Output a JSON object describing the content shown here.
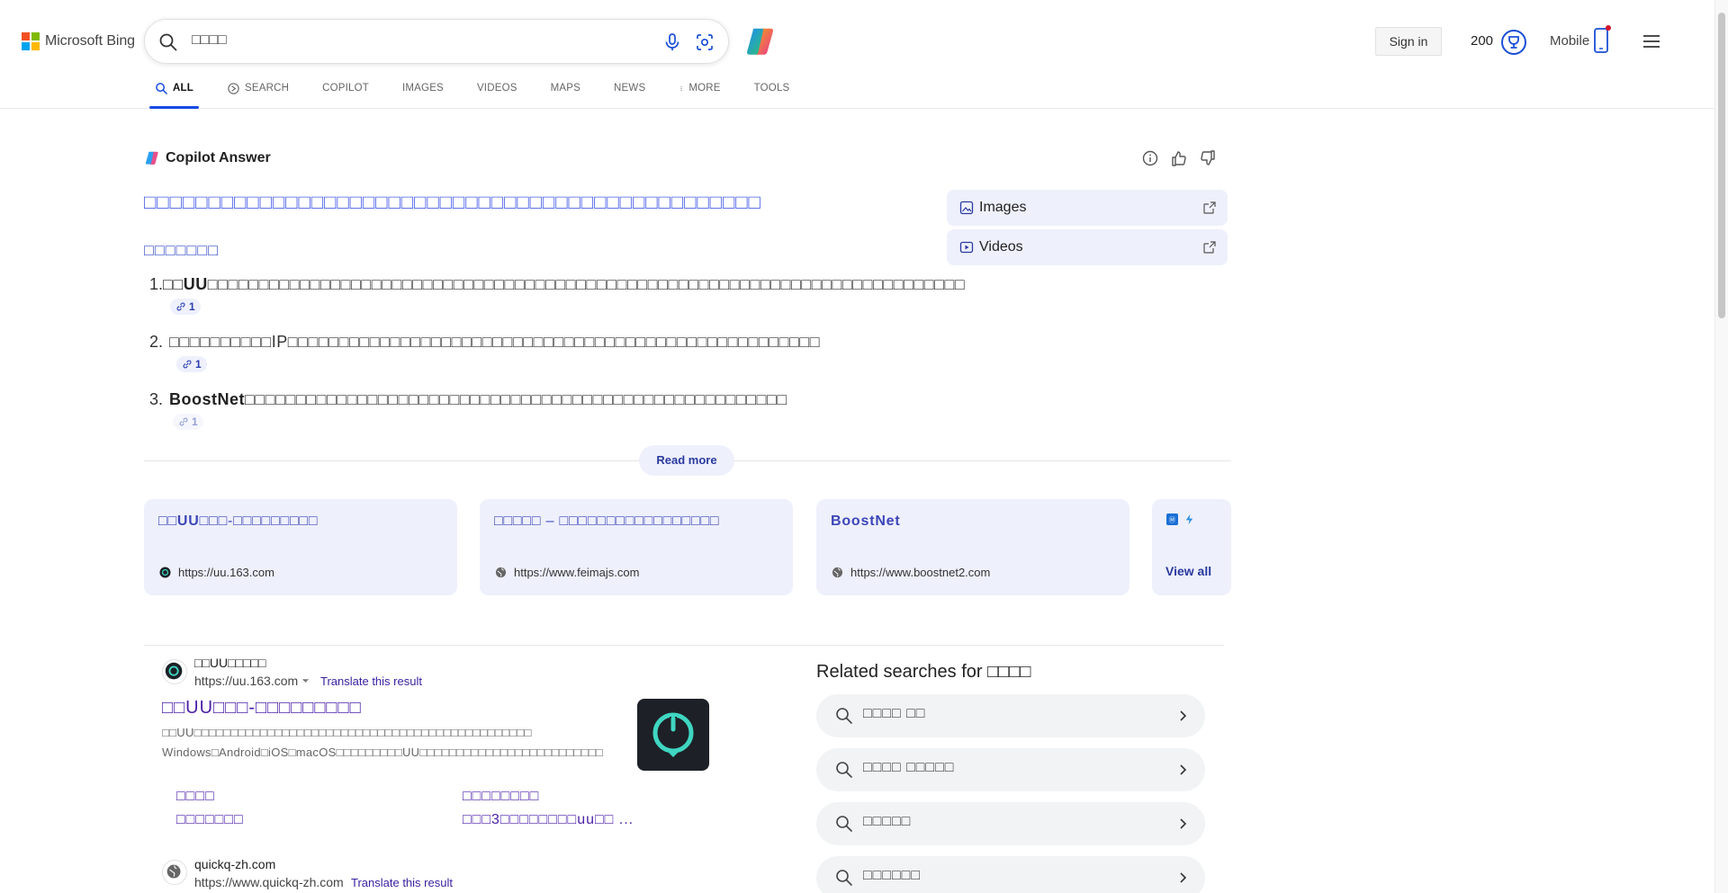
{
  "header": {
    "logo_text": "Microsoft Bing",
    "search_query": "□□□□",
    "signin_label": "Sign in",
    "points": "200",
    "mobile_label": "Mobile"
  },
  "tabs": [
    {
      "label": "ALL",
      "icon": "search-icon",
      "active": true
    },
    {
      "label": "SEARCH",
      "icon": "copilot-search-icon",
      "active": false
    },
    {
      "label": "COPILOT",
      "active": false
    },
    {
      "label": "IMAGES",
      "active": false
    },
    {
      "label": "VIDEOS",
      "active": false
    },
    {
      "label": "MAPS",
      "active": false
    },
    {
      "label": "NEWS",
      "active": false
    },
    {
      "label": "MORE",
      "icon": "more-vertical-icon",
      "active": false
    },
    {
      "label": "TOOLS",
      "active": false
    }
  ],
  "copilot_answer": {
    "header_label": "Copilot Answer",
    "title": "□□□□□□□□□□□□□□□□□□□□□□□□□□□□□□□□□□□□□□□□□□□□□□□□",
    "subhead": "□□□□□□□",
    "items": [
      {
        "num": "1.",
        "lead": "□□UU",
        "text": "□□□□□□□□□□□□□□□□□□□□□□□□□□□□□□□□□□□□□□□□□□□□□□□□□□□□□□□□□□□□□□□□□□□□□□□□□□",
        "cite": "1"
      },
      {
        "num": "2.",
        "lead": "",
        "text": "□□□□□□□□□□IP□□□□□□□□□□□□□□□□□□□□□□□□□□□□□□□□□□□□□□□□□□□□□□□□□□□□",
        "cite": "1"
      },
      {
        "num": "3.",
        "lead": "BoostNet",
        "text": "□□□□□□□□□□□□□□□□□□□□□□□□□□□□□□□□□□□□□□□□□□□□□□□□□□□□□",
        "cite": "1"
      }
    ],
    "read_more": "Read more",
    "media": [
      {
        "label": "Images"
      },
      {
        "label": "Videos"
      }
    ],
    "sources": [
      {
        "title_lead": "□□UU",
        "title": "□□□-□□□□□□□□□",
        "url": "https://uu.163.com"
      },
      {
        "title_lead": "",
        "title": "□□□□□ – □□□□□□□□□□□□□□□□□",
        "url": "https://www.feimajs.com"
      },
      {
        "title_lead": "BoostNet",
        "title": "",
        "url": "https://www.boostnet2.com"
      }
    ],
    "view_all": "View all"
  },
  "results": [
    {
      "site_name": "□□UU□□□□□",
      "url": "https://uu.163.com",
      "translate": "Translate this result",
      "title": "□□UU□□□-□□□□□□□□□",
      "snippet": "□□UU□□□□□□□□□□□□□□□□□□□□□□□□□□□□□□□□□□□□□□□□□□□□□□ Windows□Android□iOS□macOS□□□□□□□□□UU□□□□□□□□□□□□□□□□□□□□□□□□□",
      "deep_links": [
        "□□□□",
        "□□□□□□□□",
        "□□□□□□□",
        "□□□3□□□□□□□□uu□□ ..."
      ]
    },
    {
      "site_name": "quickq-zh.com",
      "url": "https://www.quickq-zh.com",
      "translate": "Translate this result"
    }
  ],
  "related": {
    "title": "Related searches for □□□□",
    "items": [
      "□□□□ □□",
      "□□□□ □□□□□",
      "□□□□□",
      "□□□□□□"
    ]
  },
  "colors": {
    "accent": "#174ae4",
    "link_visited": "#4a1fa8",
    "card_bg": "#eef0fc"
  }
}
